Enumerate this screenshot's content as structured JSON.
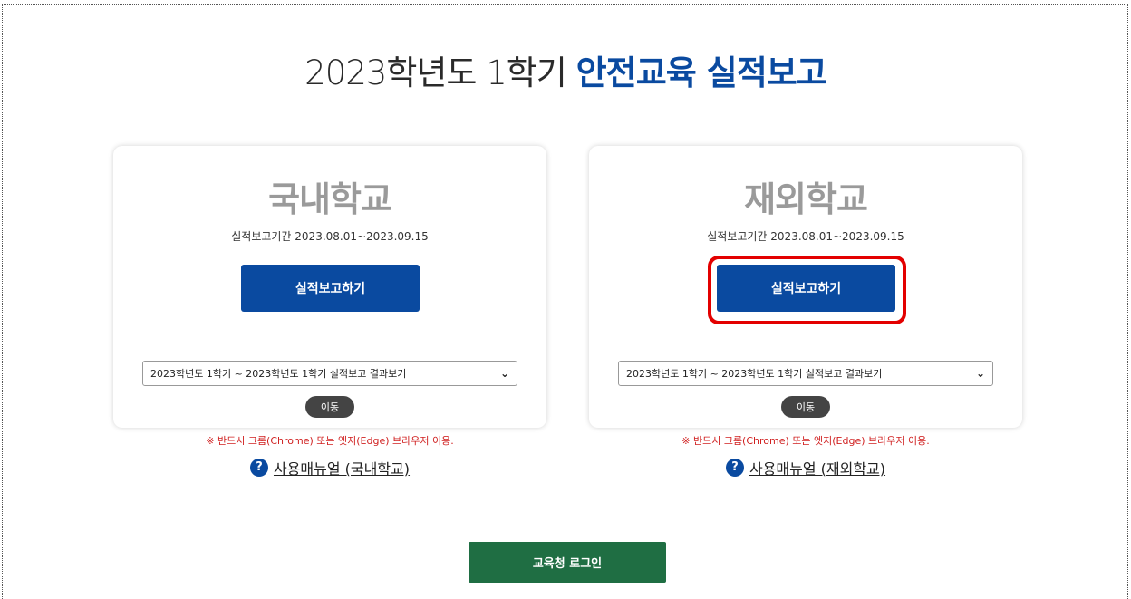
{
  "header": {
    "title_plain": "2023학년도 1학기 ",
    "title_highlight": "안전교육 실적보고"
  },
  "colors": {
    "primary_blue": "#0a4aa0",
    "login_green": "#1f6e43",
    "notice_red": "#d02020",
    "highlight_red": "#e30000"
  },
  "domestic": {
    "heading": "국내학교",
    "period": "실적보고기간 2023.08.01~2023.09.15",
    "report_label": "실적보고하기",
    "select_value": "2023학년도 1학기 ~ 2023학년도 1학기 실적보고 결과보기",
    "go_label": "이동",
    "notice": "※ 반드시 크롬(Chrome) 또는 엣지(Edge) 브라우저 이용.",
    "manual_label": "사용매뉴얼 (국내학교)",
    "help_icon": "question-circle-icon"
  },
  "overseas": {
    "heading": "재외학교",
    "period": "실적보고기간 2023.08.01~2023.09.15",
    "report_label": "실적보고하기",
    "select_value": "2023학년도 1학기 ~ 2023학년도 1학기 실적보고 결과보기",
    "go_label": "이동",
    "notice": "※ 반드시 크롬(Chrome) 또는 엣지(Edge) 브라우저 이용.",
    "manual_label": "사용매뉴얼 (재외학교)",
    "help_icon": "question-circle-icon"
  },
  "footer": {
    "login_label": "교육청 로그인"
  }
}
